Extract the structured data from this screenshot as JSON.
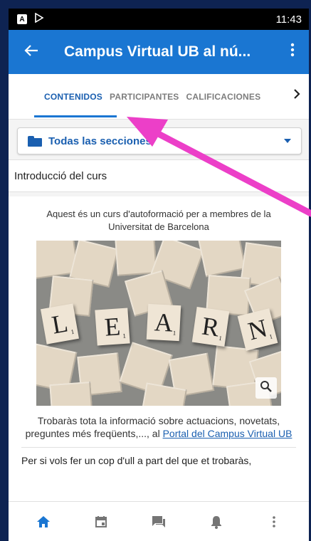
{
  "status": {
    "time": "11:43",
    "notif_label": "A"
  },
  "appbar": {
    "title": "Campus Virtual UB al nú..."
  },
  "tabs": [
    {
      "label": "CONTENIDOS",
      "active": true
    },
    {
      "label": "PARTICIPANTES",
      "active": false
    },
    {
      "label": "CALIFICACIONES",
      "active": false
    }
  ],
  "sections_selector": {
    "label": "Todas las secciones"
  },
  "section": {
    "title": "Introducció del curs"
  },
  "card": {
    "intro": "Aquest és un curs d'autoformació per a membres de la Universitat de Barcelona",
    "image_letters": [
      "L",
      "E",
      "A",
      "R",
      "N"
    ],
    "tile_scores": [
      "1",
      "1",
      "1",
      "1",
      "1"
    ],
    "caption_text": "Trobaràs tota la informació sobre actuacions, novetats, preguntes més freqüents,..., al ",
    "caption_link": "Portal del Campus Virtual UB",
    "more_text": "Per si vols fer un cop d'ull a part del que et trobaràs,"
  },
  "bottom_nav": [
    "home-icon",
    "calendar-icon",
    "messages-icon",
    "notifications-icon",
    "more-icon"
  ],
  "colors": {
    "primary": "#1a76d2",
    "accent_text": "#1a5fb0",
    "background": "#0e2352"
  }
}
